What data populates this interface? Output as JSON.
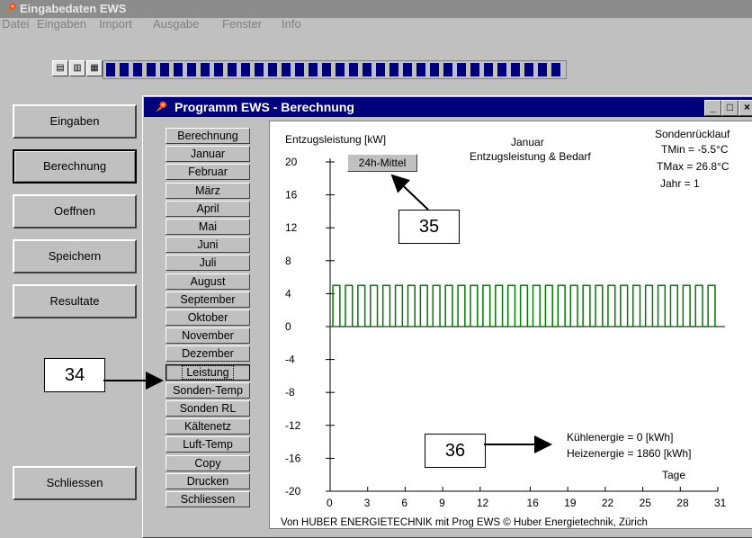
{
  "app": {
    "title": "Eingabedaten EWS"
  },
  "menu": [
    "Datei",
    "Eingaben",
    "Import",
    "Ausgabe",
    "Fenster",
    "Info"
  ],
  "left_buttons": [
    "Eingaben",
    "Berechnung",
    "Oeffnen",
    "Speichern",
    "Resultate",
    "Schliessen"
  ],
  "window": {
    "title": "Programm EWS - Berechnung",
    "min": "_",
    "max": "□",
    "close": "×"
  },
  "side_list": [
    "Berechnung",
    "Januar",
    "Februar",
    "März",
    "April",
    "Mai",
    "Juni",
    "Juli",
    "August",
    "September",
    "Oktober",
    "November",
    "Dezember",
    "Leistung",
    "Sonden-Temp",
    "Sonden RL",
    "Kältenetz",
    "Luft-Temp",
    "Copy",
    "Drucken",
    "Schliessen"
  ],
  "chart": {
    "ylabel": "Entzugsleistung [kW]",
    "month": "Januar",
    "subtitle": "Entzugsleistung & Bedarf",
    "button": "24h-Mittel",
    "info_title": "Sondenrücklauf",
    "tmin": "TMin  = -5.5°C",
    "tmax": "TMax = 26.8°C",
    "jahr": "Jahr  = 1",
    "kuehl": "Kühlenergie = 0 [kWh]",
    "heiz": "Heizenergie = 1860 [kWh]",
    "xlabel": "Tage",
    "footer": "Von HUBER ENERGIETECHNIK mit Prog EWS  © Huber Energietechnik, Zürich"
  },
  "callouts": [
    "34",
    "35",
    "36"
  ],
  "chart_data": {
    "type": "line",
    "yticks": [
      "20",
      "16",
      "12",
      "8",
      "4",
      "0",
      "-4",
      "-8",
      "-12",
      "-16",
      "-20"
    ],
    "xticks": [
      "0",
      "3",
      "6",
      "9",
      "12",
      "16",
      "19",
      "22",
      "25",
      "28",
      "31"
    ],
    "ylim": [
      -20,
      20
    ],
    "xlim": [
      0,
      31
    ],
    "series": [
      {
        "pattern": "daily pulse",
        "high": 5,
        "low": 0,
        "days": 31
      }
    ]
  }
}
